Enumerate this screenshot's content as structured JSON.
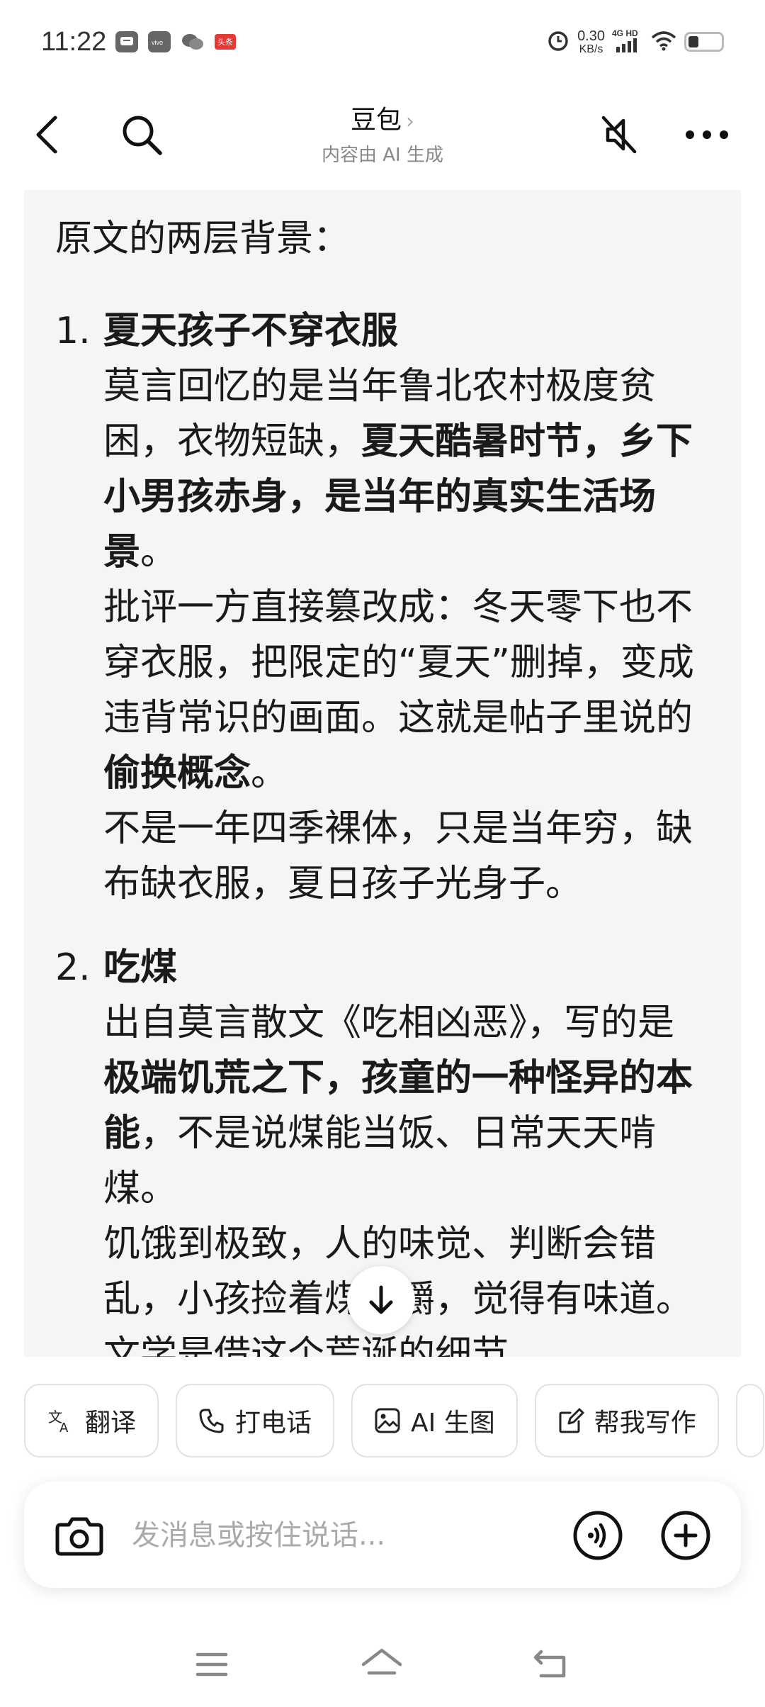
{
  "status_bar": {
    "time": "11:22",
    "notif_badge": "头条",
    "net_speed_value": "0.30",
    "net_speed_unit": "KB/s",
    "network_type": "4G HD",
    "icons": [
      "message-icon",
      "vivo-icon",
      "wechat-icon",
      "toutiao-icon",
      "alarm-icon",
      "signal-icon",
      "wifi-icon",
      "battery-icon"
    ]
  },
  "header": {
    "title": "豆包",
    "title_chevron": "›",
    "subtitle": "内容由 AI 生成",
    "icons": [
      "back-icon",
      "search-icon",
      "mute-icon",
      "more-icon"
    ]
  },
  "message": {
    "intro": "原文的两层背景：",
    "items": [
      {
        "num": "1.",
        "title": "夏天孩子不穿衣服",
        "p1_a": "莫言回忆的是当年鲁北农村极度贫困，衣物短缺，",
        "p1_bold": "夏天酷暑时节，乡下小男孩赤身，是当年的真实生活场景",
        "p1_c": "。",
        "p2_a": "批评一方直接篡改成：冬天零下也不穿衣服，把限定的“夏天”删掉，变成违背常识的画面。这就是帖子里说的",
        "p2_bold": "偷换概念",
        "p2_c": "。",
        "p3": "不是一年四季裸体，只是当年穷，缺布缺衣服，夏日孩子光身子。"
      },
      {
        "num": "2.",
        "title": "吃煤",
        "p1_a": "出自莫言散文《吃相凶恶》，写的是",
        "p1_bold": "极端饥荒之下，孩童的一种怪异的本能",
        "p1_c": "，不是说煤能当饭、日常天天啃煤。",
        "p2": "饥饿到极致，人的味觉、判断会错乱，小孩捡着煤块嚼，觉得有味道。文学是借这个荒诞的细节，"
      }
    ]
  },
  "chips": [
    {
      "label": "翻译",
      "icon": "translate-icon"
    },
    {
      "label": "打电话",
      "icon": "phone-icon"
    },
    {
      "label": "AI 生图",
      "icon": "image-icon"
    },
    {
      "label": "帮我写作",
      "icon": "edit-icon"
    }
  ],
  "input": {
    "placeholder": "发消息或按住说话...",
    "icons": [
      "camera-icon",
      "voice-call-icon",
      "plus-icon"
    ]
  },
  "navbar": {
    "icons": [
      "menu-icon",
      "home-icon",
      "back-nav-icon"
    ]
  }
}
